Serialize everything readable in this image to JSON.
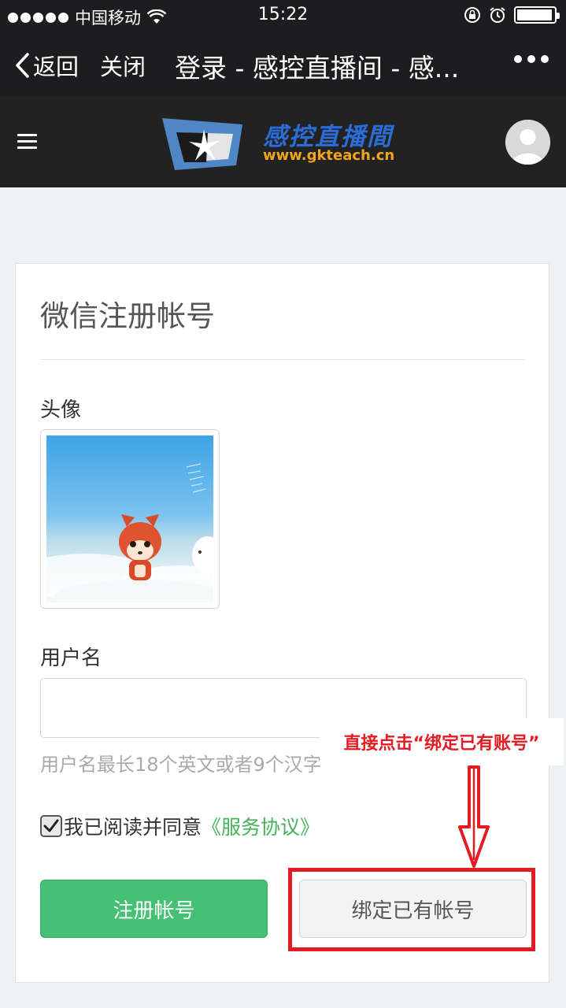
{
  "status_bar": {
    "carrier": "中国移动",
    "time": "15:22",
    "battery_level": 0.95
  },
  "nav_bar": {
    "back_label": "返回",
    "close_label": "关闭",
    "title": "登录 - 感控直播间 - 感..."
  },
  "site_header": {
    "brand_name": "感控直播間",
    "brand_url": "www.gkteach.cn"
  },
  "form": {
    "title": "微信注册帐号",
    "avatar_label": "头像",
    "username_label": "用户名",
    "username_value": "",
    "username_hint": "用户名最长18个英文或者9个汉字",
    "agree_checked": true,
    "agree_text": "我已阅读并同意",
    "terms_link": "《服务协议》",
    "register_button": "注册帐号",
    "bind_button": "绑定已有帐号"
  },
  "annotation": {
    "instruction": "直接点击“绑定已有账号”",
    "color": "#e31b23"
  },
  "colors": {
    "primary_green": "#44c174",
    "link_green": "#47b35b",
    "dark_bar": "#1d1d1f",
    "header_bg": "#222222"
  }
}
